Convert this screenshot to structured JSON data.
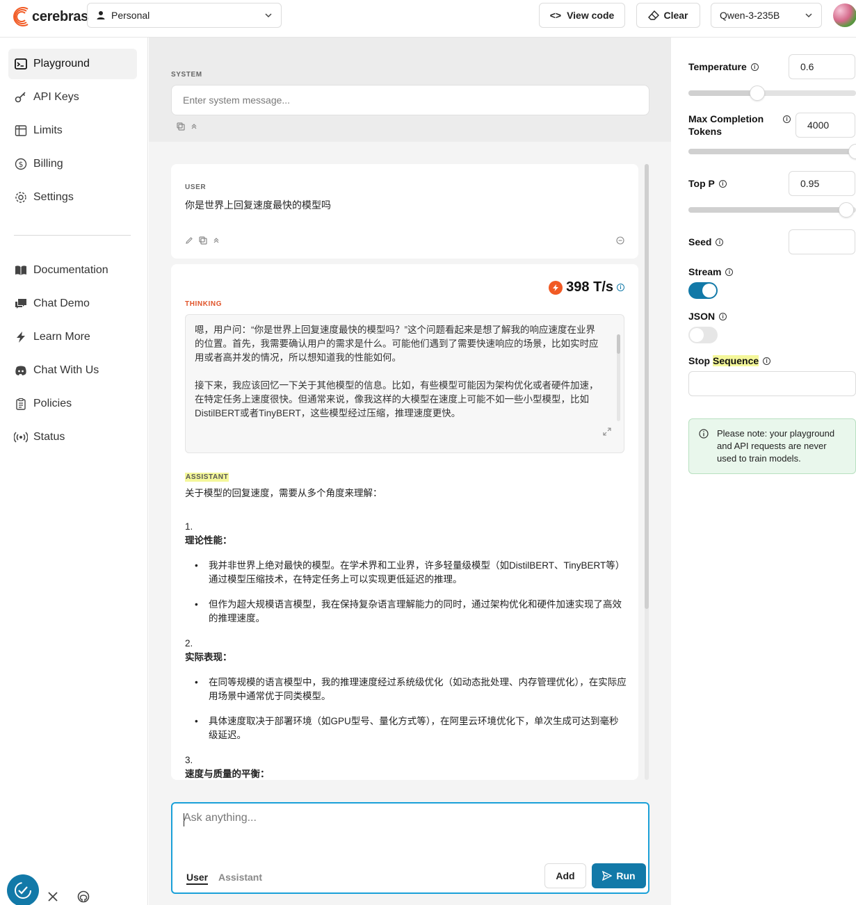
{
  "brand": {
    "name": "cerebras"
  },
  "header": {
    "workspace": "Personal",
    "view_code": "View code",
    "clear": "Clear",
    "model": "Qwen-3-235B"
  },
  "sidebar": {
    "items": [
      {
        "label": "Playground",
        "icon": "terminal-icon",
        "active": true
      },
      {
        "label": "API Keys",
        "icon": "key-icon"
      },
      {
        "label": "Limits",
        "icon": "table-icon"
      },
      {
        "label": "Billing",
        "icon": "dollar-icon"
      },
      {
        "label": "Settings",
        "icon": "gear-icon"
      }
    ],
    "links": [
      {
        "label": "Documentation",
        "icon": "book-icon"
      },
      {
        "label": "Chat Demo",
        "icon": "chat-icon"
      },
      {
        "label": "Learn More",
        "icon": "lightning-icon"
      },
      {
        "label": "Chat With Us",
        "icon": "discord-icon"
      },
      {
        "label": "Policies",
        "icon": "clipboard-icon"
      },
      {
        "label": "Status",
        "icon": "broadcast-icon"
      }
    ]
  },
  "system": {
    "label": "SYSTEM",
    "placeholder": "Enter system message..."
  },
  "conversation": {
    "user": {
      "label": "USER",
      "text": "你是世界上回复速度最快的模型吗"
    },
    "assistant": {
      "tokens_per_sec": "398 T/s",
      "thinking_label": "THINKING",
      "thinking_p1": "嗯，用户问：“你是世界上回复速度最快的模型吗？”这个问题看起来是想了解我的响应速度在业界的位置。首先，我需要确认用户的需求是什么。可能他们遇到了需要快速响应的场景，比如实时应用或者高并发的情况，所以想知道我的性能如何。",
      "thinking_p2": "接下来，我应该回忆一下关于其他模型的信息。比如，有些模型可能因为架构优化或者硬件加速，在特定任务上速度很快。但通常来说，像我这样的大模型在速度上可能不如一些小型模型，比如DistilBERT或者TinyBERT，这些模型经过压缩，推理速度更快。",
      "label": "ASSISTANT",
      "intro": "关于模型的回复速度，需要从多个角度来理解：",
      "sections": [
        {
          "num": "1.",
          "heading": "理论性能：",
          "bullets": [
            "我并非世界上绝对最快的模型。在学术界和工业界，许多轻量级模型（如DistilBERT、TinyBERT等）通过模型压缩技术，在特定任务上可以实现更低延迟的推理。",
            "但作为超大规模语言模型，我在保持复杂语言理解能力的同时，通过架构优化和硬件加速实现了高效的推理速度。"
          ]
        },
        {
          "num": "2.",
          "heading": "实际表现：",
          "bullets": [
            "在同等规模的语言模型中，我的推理速度经过系统级优化（如动态批处理、内存管理优化），在实际应用场景中通常优于同类模型。",
            "具体速度取决于部署环境（如GPU型号、量化方式等），在阿里云环境优化下，单次生成可达到毫秒级延迟。"
          ]
        },
        {
          "num": "3.",
          "heading": "速度与质量的平衡：",
          "bullets": []
        }
      ]
    }
  },
  "composer": {
    "placeholder": "Ask anything...",
    "tab_user": "User",
    "tab_assistant": "Assistant",
    "add": "Add",
    "run": "Run"
  },
  "params": {
    "temperature": {
      "label": "Temperature",
      "value": "0.6",
      "slider_fraction": 0.41
    },
    "max_tokens": {
      "label_line1": "Max Completion",
      "label_line2": "Tokens",
      "value": "4000",
      "slider_fraction": 1.0
    },
    "top_p": {
      "label": "Top P",
      "value": "0.95",
      "slider_fraction": 0.94
    },
    "seed": {
      "label": "Seed",
      "value": ""
    },
    "stream": {
      "label": "Stream",
      "on": true
    },
    "json": {
      "label": "JSON",
      "on": false
    },
    "stop_sequence": {
      "label_a": "Stop ",
      "label_b": "Sequence"
    },
    "note": "Please note: your playground and API requests are never used to train models."
  },
  "colors": {
    "accent": "#1279a8",
    "brand_orange": "#f15a24",
    "note_bg": "#e9f7ec"
  }
}
